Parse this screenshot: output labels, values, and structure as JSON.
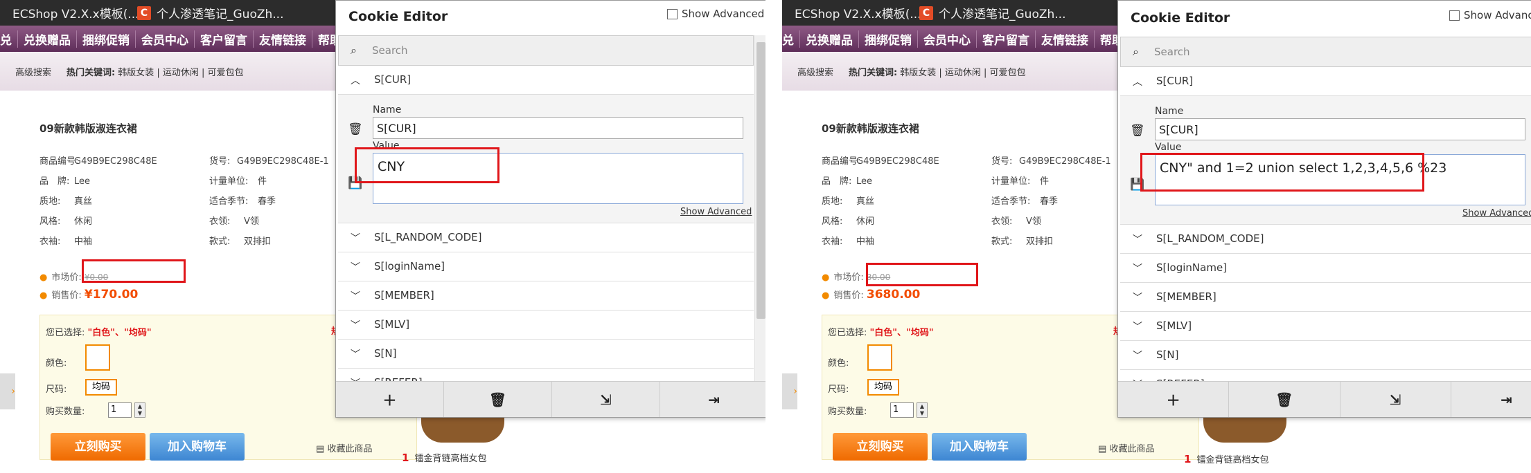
{
  "browser": {
    "tab1": "ECShop V2.X.x模板(...",
    "tab2": "个人渗透笔记_GuoZh...",
    "tab_icon_letter": "C"
  },
  "site": {
    "nav": [
      "兑换赠品",
      "捆绑促销",
      "会员中心",
      "客户留言",
      "友情链接",
      "帮助"
    ],
    "subbar": {
      "advanced": "高级搜索",
      "hot_label": "热门关键词:",
      "hot_words": "韩版女装 | 运动休闲 | 可爱包包"
    },
    "product_title": "09新款韩版淑连衣裙",
    "attrs_left": [
      {
        "k": "商品编号:",
        "v": "G49B9EC298C48E"
      },
      {
        "k": "品　牌:",
        "v": "Lee"
      },
      {
        "k": "质地:",
        "v": "真丝"
      },
      {
        "k": "风格:",
        "v": "休闲"
      },
      {
        "k": "衣袖:",
        "v": "中袖"
      }
    ],
    "attrs_right": [
      {
        "k": "货号:",
        "v": "G49B9EC298C48E-1"
      },
      {
        "k": "计量单位:",
        "v": "件"
      },
      {
        "k": "适合季节:",
        "v": "春季"
      },
      {
        "k": "衣领:",
        "v": "V领"
      },
      {
        "k": "款式:",
        "v": "双排扣"
      }
    ],
    "market_label": "市场价:",
    "sale_label": "销售价:",
    "selected_label": "您已选择:",
    "selected_value": "\"白色\"、\"均码\"",
    "color_label": "颜色:",
    "size_label": "尺码:",
    "size_value": "均码",
    "qty_label": "购买数量:",
    "qty_value": "1",
    "buy_now": "立刻购买",
    "add_cart": "加入购物车",
    "favorite": "收藏此商品",
    "rank_item": "镭金背链高档女包",
    "rank_num": "1",
    "edge_char": "规"
  },
  "left": {
    "market_price": "¥0.00",
    "sale_price": "¥170.00",
    "cookie_value": "CNY"
  },
  "right": {
    "market_price": "30.00",
    "sale_price": "3680.00",
    "cookie_value": "CNY\" and 1=2 union select 1,2,3,4,5,6 %23"
  },
  "cookie_editor": {
    "title": "Cookie Editor",
    "show_advanced": "Show Advanced",
    "search_placeholder": "Search",
    "expanded_cookie": "S[CUR]",
    "name_label": "Name",
    "name_value": "S[CUR]",
    "value_label": "Value",
    "show_advanced_link": "Show Advanced",
    "cookies": [
      "S[L_RANDOM_CODE]",
      "S[loginName]",
      "S[MEMBER]",
      "S[MLV]",
      "S[N]",
      "S[REFER]"
    ],
    "toolbar": [
      "add-icon",
      "delete-all-icon",
      "import-icon",
      "export-icon"
    ]
  },
  "colors": {
    "accent_red": "#e0161a",
    "orange": "#f28a00",
    "nav_purple": "#6e3a68"
  }
}
